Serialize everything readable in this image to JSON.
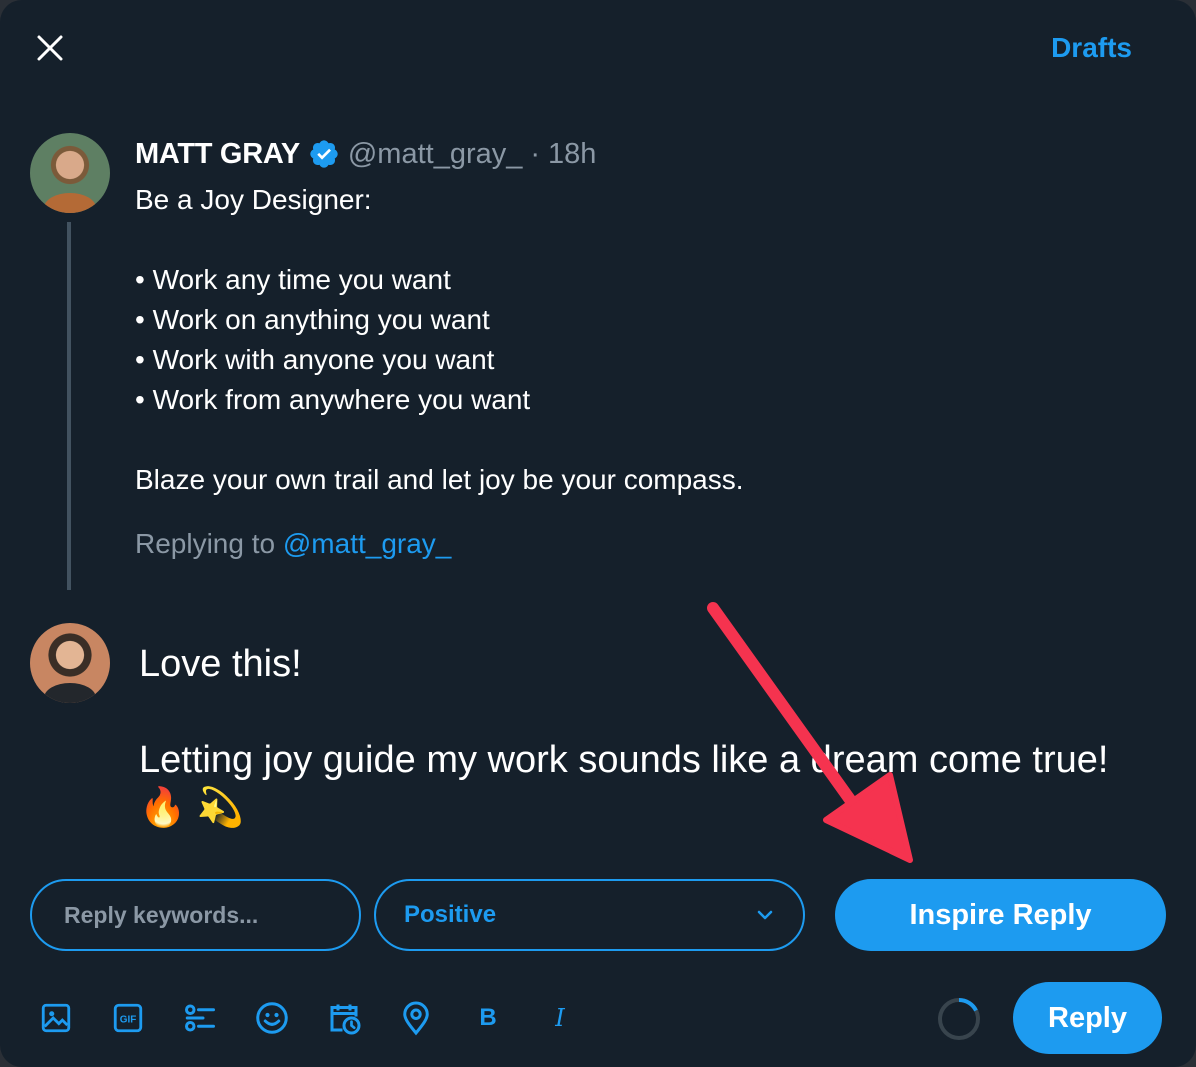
{
  "header": {
    "drafts_label": "Drafts"
  },
  "original_tweet": {
    "author_name": "MATT GRAY",
    "handle": "@matt_gray_",
    "separator": "·",
    "time": "18h",
    "lines": [
      "Be a Joy Designer:",
      "",
      "• Work any time you want",
      "• Work on anything you want",
      "• Work with anyone you want",
      "• Work from anywhere you want",
      "",
      "Blaze your own trail and let joy be your compass."
    ],
    "replying_prefix": "Replying to",
    "replying_handle": "@matt_gray_"
  },
  "reply_draft": {
    "lines": [
      "Love this!",
      "",
      "Letting joy guide my work sounds like a dream come true! 🔥 💫"
    ]
  },
  "inspire": {
    "keywords_placeholder": "Reply keywords...",
    "keywords_value": "",
    "tone_value": "Positive",
    "button_label": "Inspire Reply"
  },
  "composer": {
    "reply_button_label": "Reply",
    "bold_label": "B",
    "italic_label": "I",
    "gif_label": "GIF",
    "tools": [
      "image-icon",
      "gif-icon",
      "poll-icon",
      "emoji-icon",
      "schedule-icon",
      "location-icon",
      "bold-icon",
      "italic-icon"
    ]
  },
  "colors": {
    "background": "#15202b",
    "accent": "#1d9bf0",
    "muted": "#8b98a5",
    "annotation_arrow": "#f5334f"
  }
}
